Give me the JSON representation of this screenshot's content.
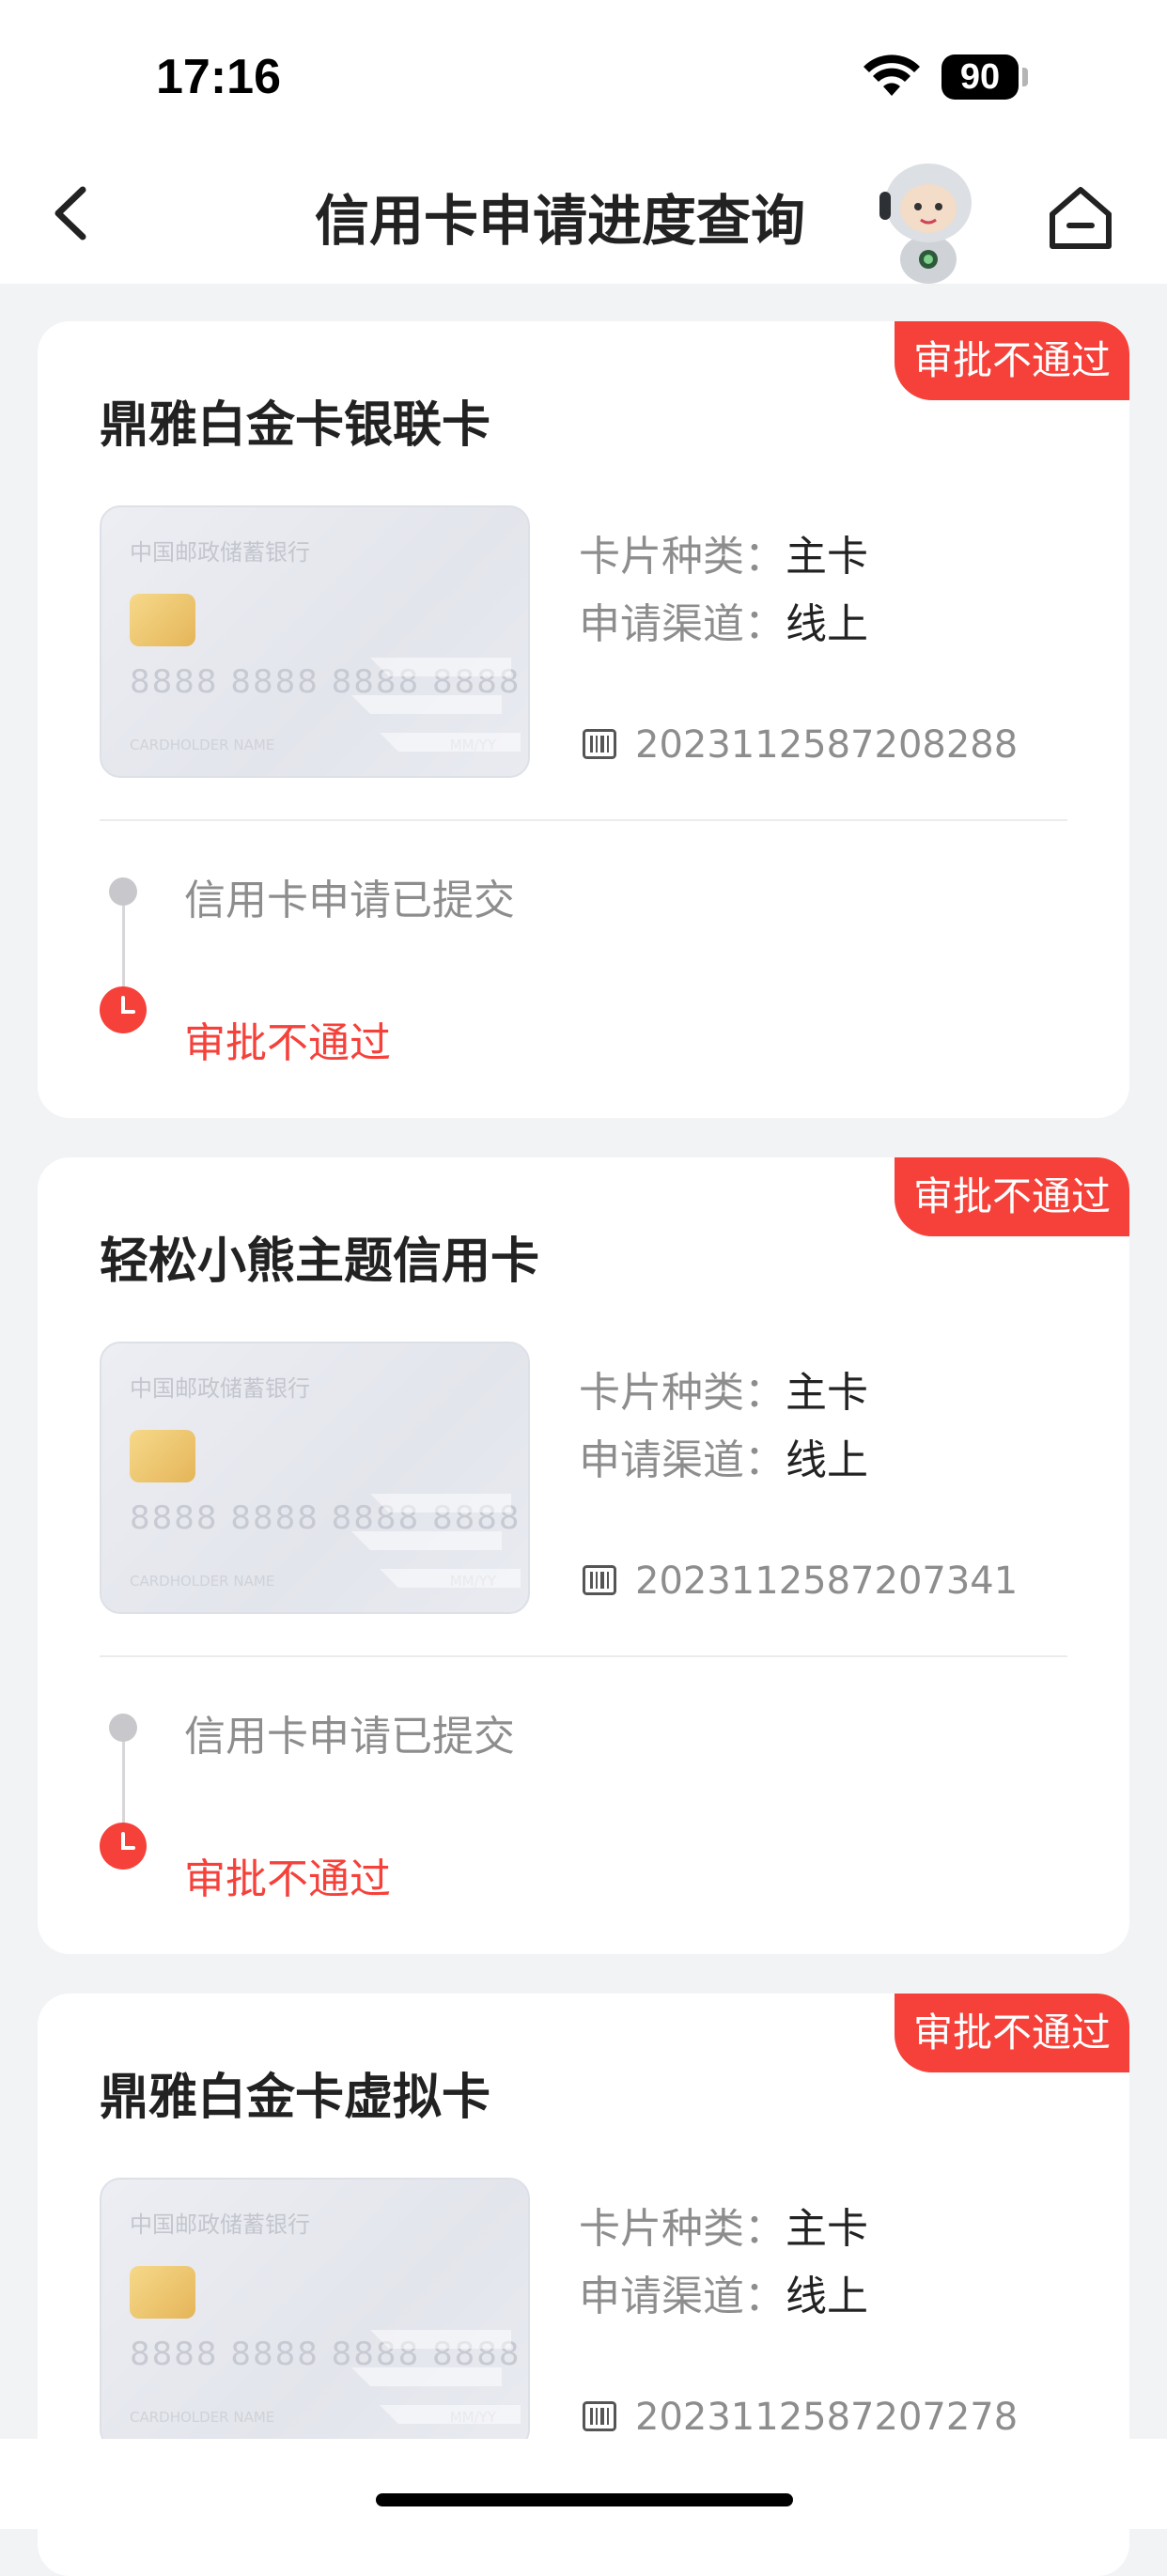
{
  "status_bar": {
    "time": "17:16",
    "battery": "90"
  },
  "nav": {
    "title": "信用卡申请进度查询"
  },
  "card_template": {
    "bank_name": "中国邮政储蓄银行",
    "number": "8888 8888 8888 8888",
    "holder": "CARDHOLDER NAME",
    "expiry": "MM/YY",
    "type_label": "卡片种类：",
    "channel_label": "申请渠道："
  },
  "applications": [
    {
      "name": "鼎雅白金卡银联卡",
      "status": "审批不通过",
      "card_type": "主卡",
      "channel": "线上",
      "app_no": "2023112587208288",
      "steps": [
        "信用卡申请已提交",
        "审批不通过"
      ]
    },
    {
      "name": "轻松小熊主题信用卡",
      "status": "审批不通过",
      "card_type": "主卡",
      "channel": "线上",
      "app_no": "2023112587207341",
      "steps": [
        "信用卡申请已提交",
        "审批不通过"
      ]
    },
    {
      "name": "鼎雅白金卡虚拟卡",
      "status": "审批不通过",
      "card_type": "主卡",
      "channel": "线上",
      "app_no": "2023112587207278"
    }
  ],
  "colors": {
    "accent": "#f5413a",
    "background": "#f2f3f5",
    "muted": "#8d8d8d"
  }
}
